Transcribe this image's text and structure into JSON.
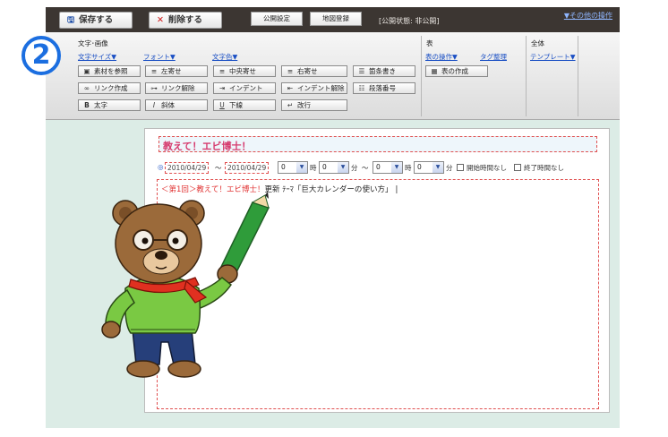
{
  "topbar": {
    "save_label": "保存する",
    "delete_label": "削除する",
    "publish_settings": "公開設定",
    "map_register": "地図登録",
    "status": "[公開状態: 非公開]",
    "other_ops": "▼その他の操作"
  },
  "toolbar": {
    "text_group_title": "文字･画像",
    "table_group_title": "表",
    "all_group_title": "全体",
    "dropdowns": {
      "text_size": "文字サイズ▼",
      "font": "フォント▼",
      "text_color": "文字色▼",
      "table_ops": "表の操作▼",
      "tag_cleanup": "タグ整理",
      "template": "テンプレート▼"
    },
    "buttons": {
      "material": "素材を参照",
      "align_left": "左寄せ",
      "align_center": "中央寄せ",
      "align_right": "右寄せ",
      "bullets": "箇条書き",
      "link_create": "リンク作成",
      "link_remove": "リンク解除",
      "indent": "インデント",
      "outdent": "インデント解除",
      "numbering": "段落番号",
      "bold": "太字",
      "italic": "斜体",
      "underline": "下線",
      "linebreak": "改行",
      "table_create": "表の作成"
    },
    "icons": {
      "material": "image-icon",
      "align_left": "align-left-icon",
      "align_center": "align-center-icon",
      "align_right": "align-right-icon",
      "bullets": "bullet-list-icon",
      "link_create": "link-icon",
      "link_remove": "unlink-icon",
      "indent": "indent-icon",
      "outdent": "outdent-icon",
      "numbering": "numbered-list-icon",
      "bold": "bold-icon",
      "italic": "italic-icon",
      "underline": "underline-icon",
      "linebreak": "line-break-icon",
      "table_create": "table-icon"
    }
  },
  "badge": "2",
  "editor": {
    "title": "教えて！エビ博士！",
    "date_start": "2010/04/29",
    "tilde1": "～",
    "date_end": "2010/04/29",
    "hour1": "0",
    "hour_label": "時",
    "min1": "0",
    "min_label": "分",
    "tilde2": "～",
    "hour2": "0",
    "min2": "0",
    "no_start_time": "開始時間なし",
    "no_end_time": "終了時間なし",
    "body_red": "＜第1回＞教えて！エビ博士！",
    "body_rest": "更新 ﾃｰﾏ「巨大カレンダーの使い方」"
  },
  "colors": {
    "topbar_bg": "#3c3632",
    "page_bg": "#dcece6",
    "link_blue": "#1a4fc4",
    "title_pink": "#d63a6e",
    "badge_blue": "#1b6ee0"
  }
}
